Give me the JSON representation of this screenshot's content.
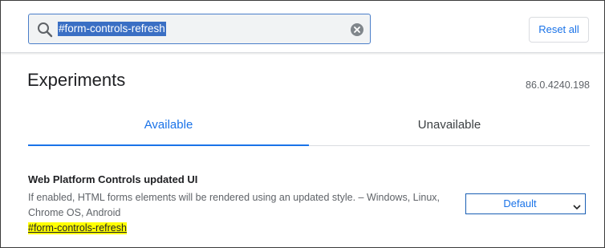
{
  "header": {
    "search": {
      "value": "#form-controls-refresh",
      "icon": "search-icon",
      "clear_icon": "close-icon"
    },
    "reset_label": "Reset all"
  },
  "main": {
    "title": "Experiments",
    "version": "86.0.4240.198",
    "tabs": [
      {
        "label": "Available",
        "selected": true
      },
      {
        "label": "Unavailable",
        "selected": false
      }
    ],
    "experiment": {
      "title": "Web Platform Controls updated UI",
      "description": "If enabled, HTML forms elements will be rendered using an updated style. – Windows, Linux, Chrome OS, Android",
      "link": "#form-controls-refresh",
      "select_value": "Default"
    }
  },
  "colors": {
    "accent": "#1a73e8",
    "highlight": "#ffff00",
    "selection": "#3a6fc4"
  }
}
